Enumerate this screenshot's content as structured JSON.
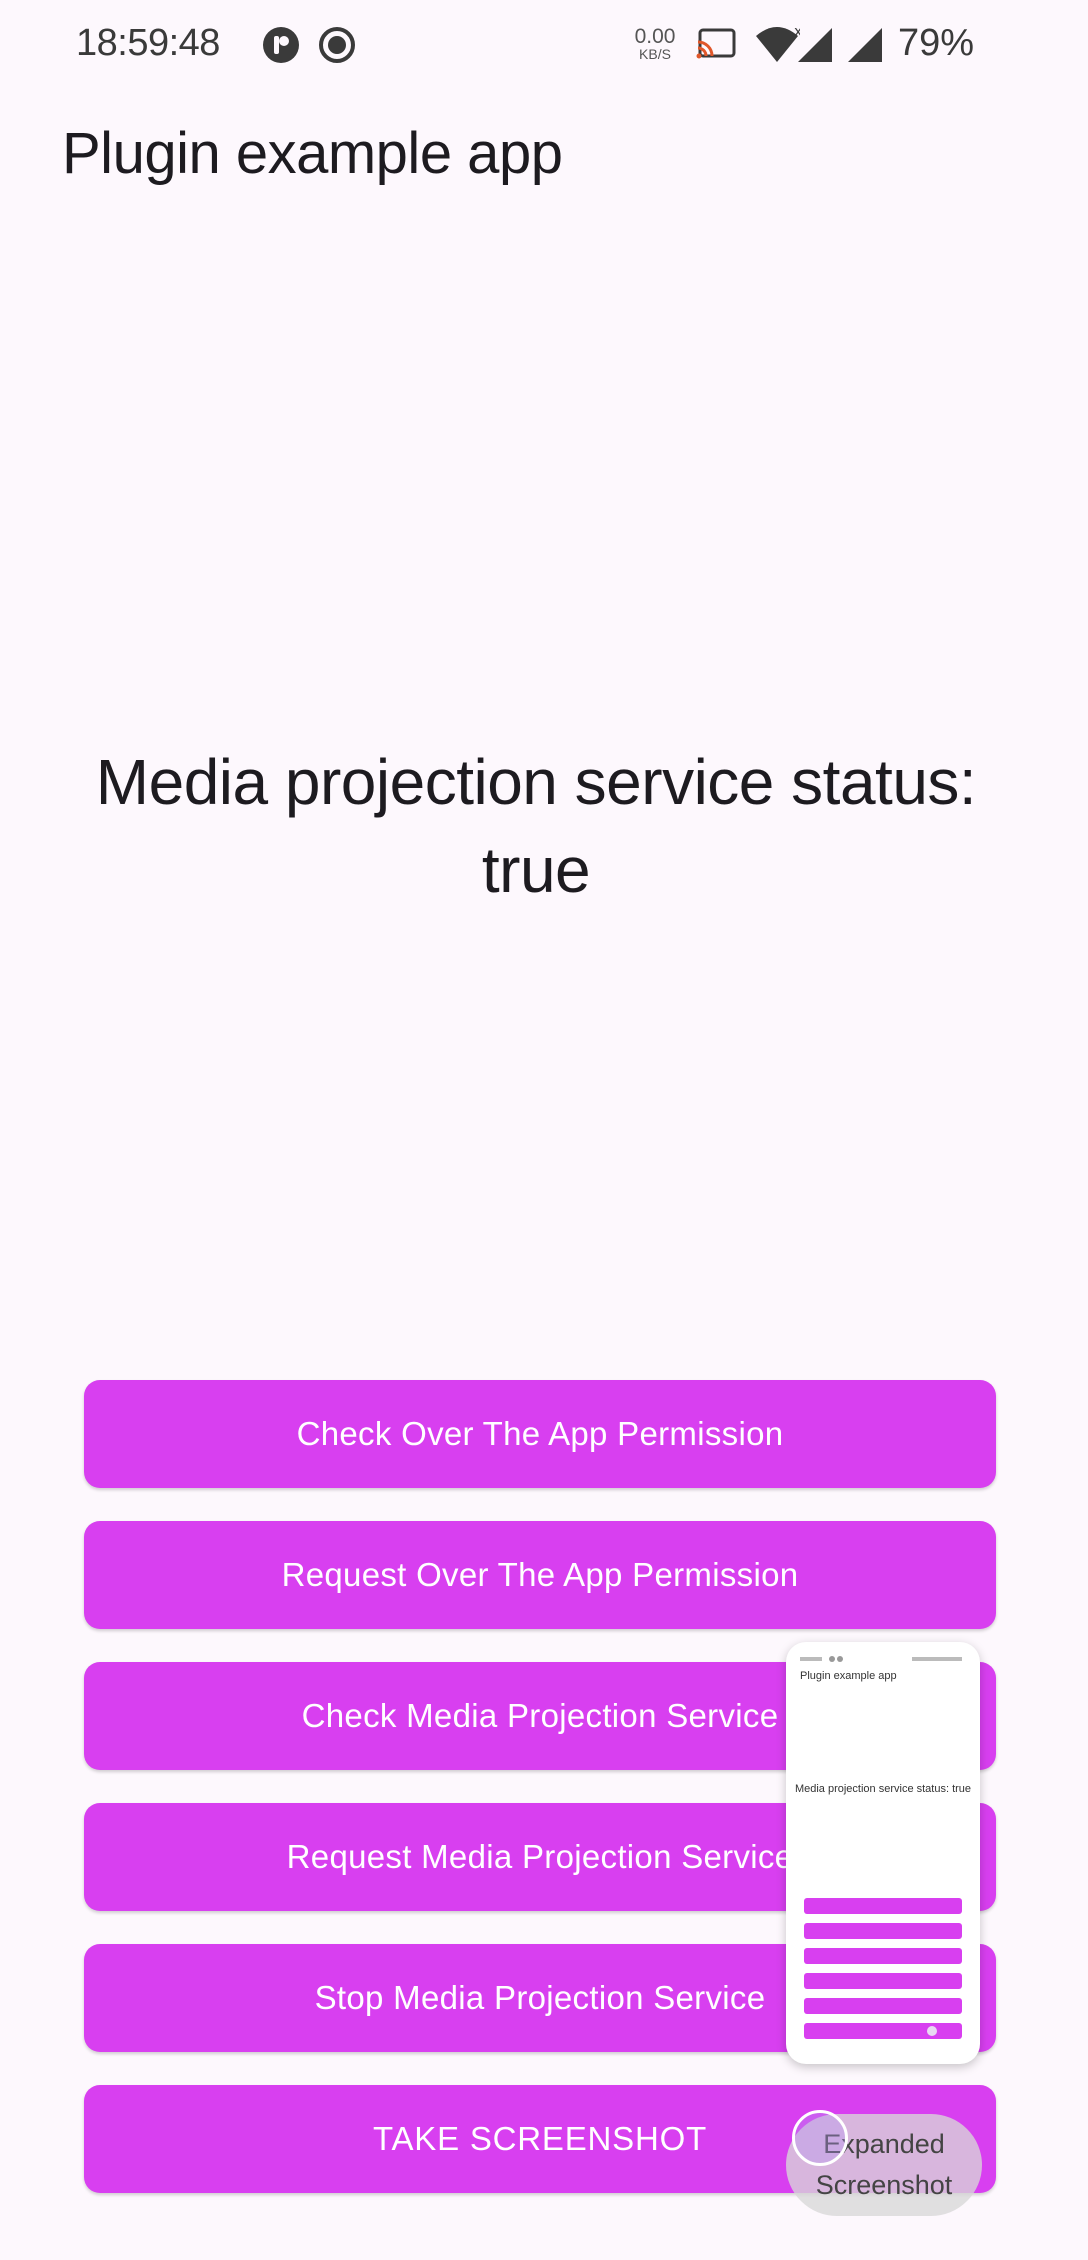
{
  "status_bar": {
    "time": "18:59:48",
    "net_speed_value": "0.00",
    "net_speed_unit": "KB/S",
    "battery": "79%",
    "icons": [
      "app-notification-icon",
      "record-icon",
      "cast-icon",
      "wifi-icon",
      "signal-icon",
      "signal-icon"
    ]
  },
  "app": {
    "title": "Plugin example app"
  },
  "main": {
    "status_text": "Media projection service status: true"
  },
  "buttons": [
    {
      "label": "Check Over The App Permission"
    },
    {
      "label": "Request Over The App Permission"
    },
    {
      "label": "Check Media Projection Service"
    },
    {
      "label": "Request Media Projection Service"
    },
    {
      "label": "Stop Media Projection Service"
    },
    {
      "label": "TAKE SCREENSHOT"
    }
  ],
  "preview": {
    "title": "Plugin example app",
    "status_text": "Media projection service status: true"
  },
  "expanded_screenshot": {
    "label": "Expanded Screenshot"
  },
  "colors": {
    "accent": "#d83ff0",
    "background": "#fdf8fd"
  }
}
